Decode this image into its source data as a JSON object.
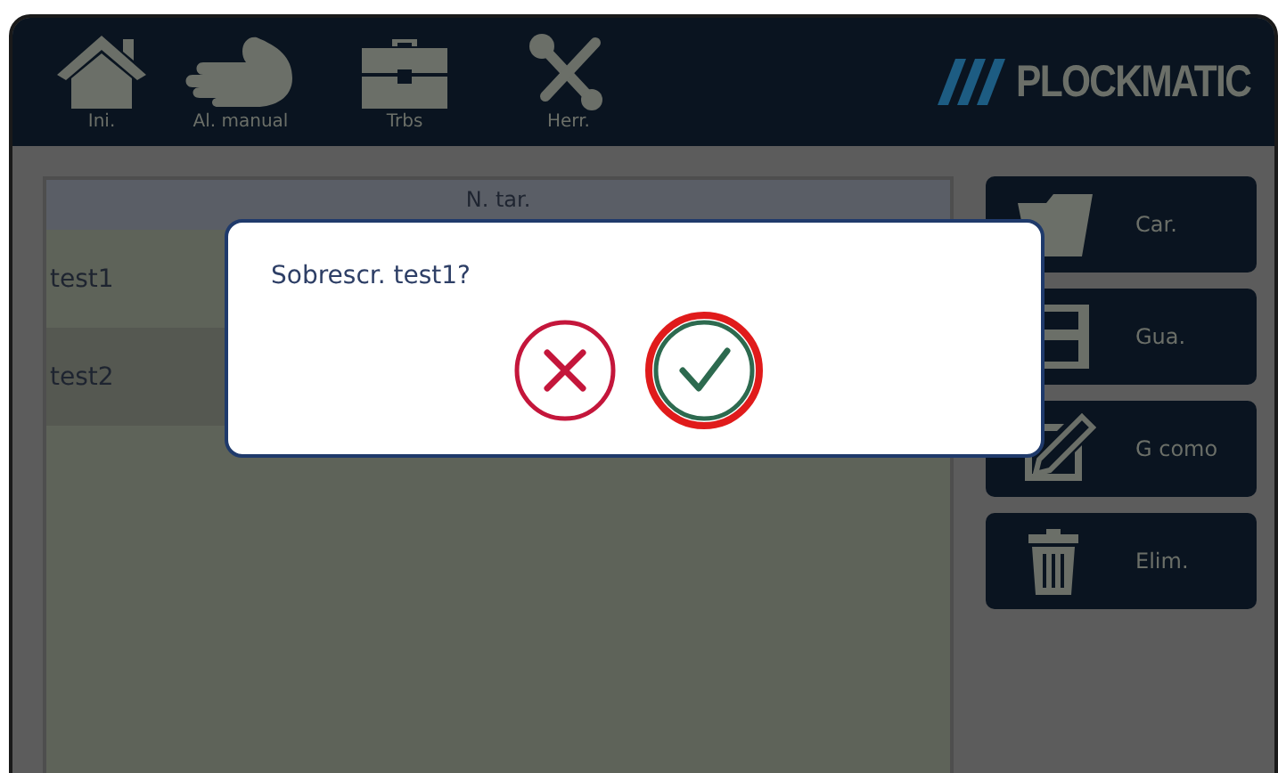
{
  "nav": [
    {
      "label": "Ini.",
      "kind": "home"
    },
    {
      "label": "Al. manual",
      "kind": "hand"
    },
    {
      "label": "Trbs",
      "kind": "briefcase"
    },
    {
      "label": "Herr.",
      "kind": "tools"
    }
  ],
  "logo": {
    "text": "PLOCKMATIC"
  },
  "table": {
    "columns": [
      "N. tar."
    ],
    "rows": [
      {
        "name": "test1"
      },
      {
        "name": "test2"
      }
    ]
  },
  "actions": [
    {
      "label": "Car.",
      "kind": "folder"
    },
    {
      "label": "Gua.",
      "kind": "save"
    },
    {
      "label": "G como",
      "kind": "edit"
    },
    {
      "label": "Elim.",
      "kind": "trash"
    }
  ],
  "dialog": {
    "message": "Sobrescr. test1?",
    "buttons": [
      {
        "kind": "cancel",
        "focused": false
      },
      {
        "kind": "confirm",
        "focused": true
      }
    ]
  }
}
